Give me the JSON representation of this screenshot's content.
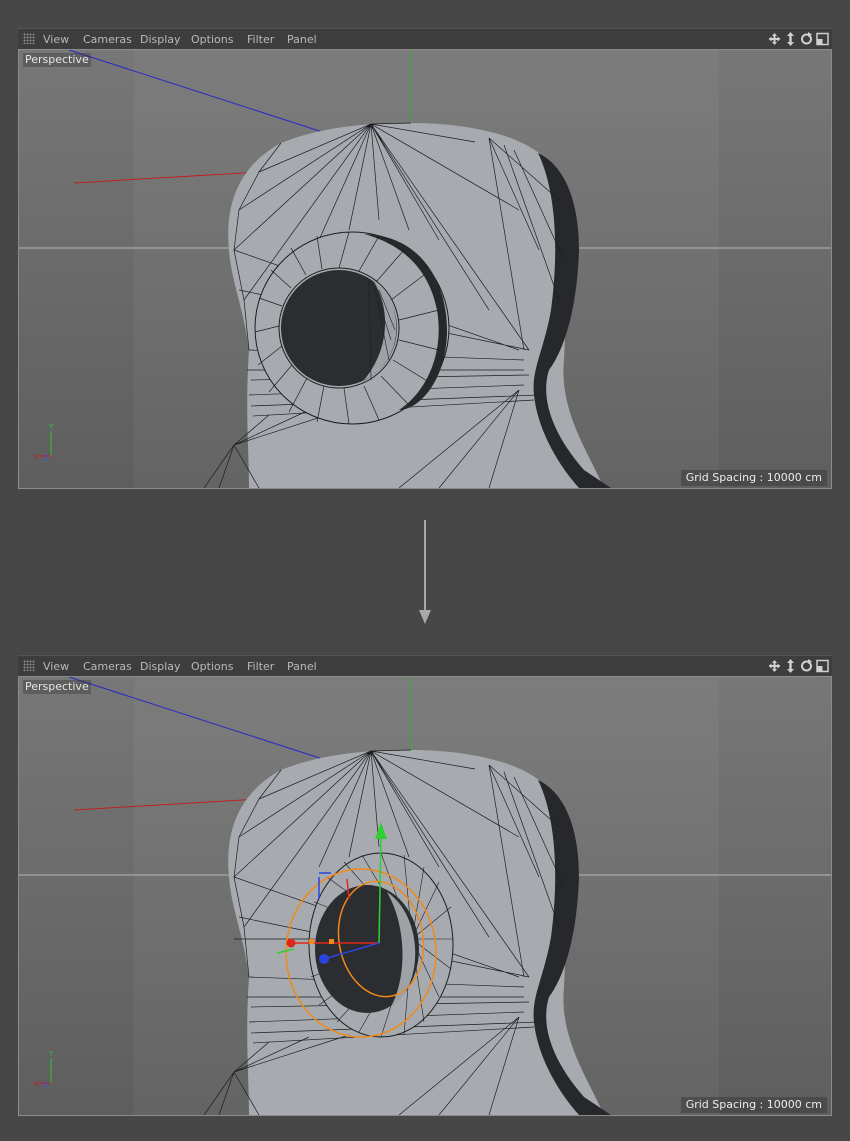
{
  "menu": {
    "view": "View",
    "cameras": "Cameras",
    "display": "Display",
    "options": "Options",
    "filter": "Filter",
    "panel": "Panel"
  },
  "viewport": {
    "camera": "Perspective",
    "grid_spacing": "Grid Spacing : 10000 cm"
  },
  "icons": [
    "move-view-icon",
    "dolly-view-icon",
    "rotate-view-icon",
    "maximize-view-icon",
    "down-arrow-icon"
  ],
  "colors": {
    "app_bg": "#474747",
    "axis_x": "#c02020",
    "axis_y": "#30c030",
    "axis_z": "#2828c8",
    "selection": "#f08a1a",
    "mesh": "#a8acb1"
  }
}
